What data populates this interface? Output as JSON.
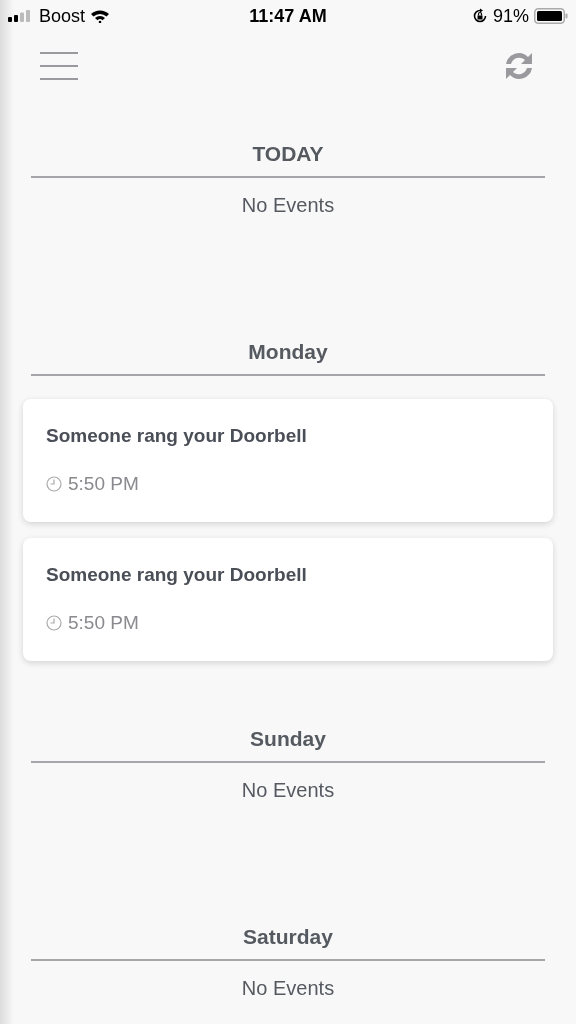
{
  "status_bar": {
    "carrier": "Boost",
    "time": "11:47 AM",
    "battery": "91%"
  },
  "days": [
    {
      "title": "TODAY",
      "empty_text": "No Events"
    },
    {
      "title": "Monday",
      "events": [
        {
          "title": "Someone rang your Doorbell",
          "time": "5:50 PM"
        },
        {
          "title": "Someone rang your Doorbell",
          "time": "5:50 PM"
        }
      ]
    },
    {
      "title": "Sunday",
      "empty_text": "No Events"
    },
    {
      "title": "Saturday",
      "empty_text": "No Events"
    }
  ]
}
